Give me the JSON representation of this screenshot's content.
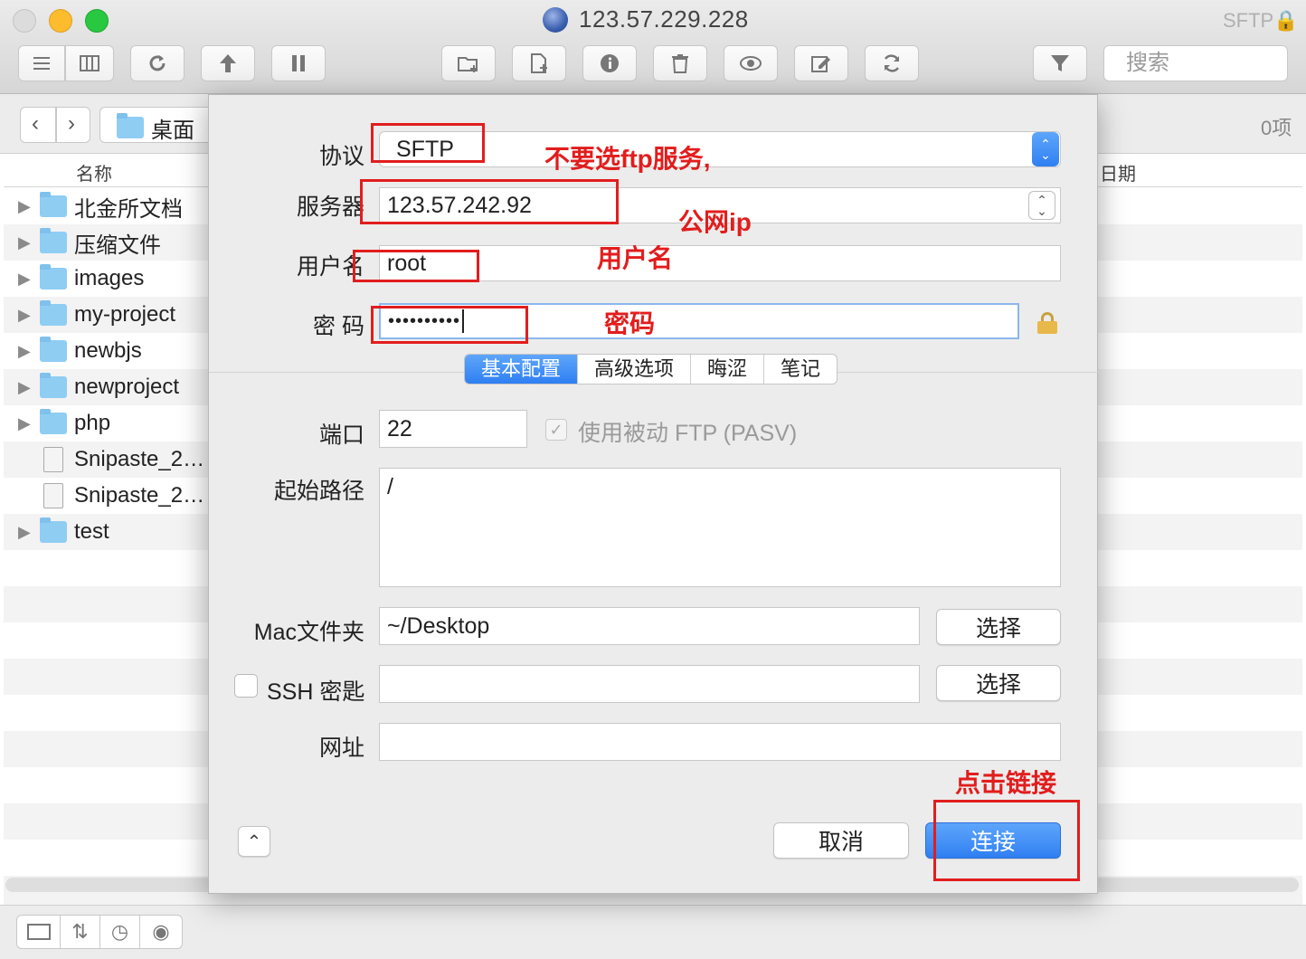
{
  "window": {
    "title": "123.57.229.228",
    "protocol_badge": "SFTP",
    "search_placeholder": "搜索"
  },
  "toolbar": {
    "icons": [
      "list-view-icon",
      "column-view-icon",
      "refresh-icon",
      "upload-icon",
      "pause-icon",
      "new-folder-icon",
      "new-file-icon",
      "info-icon",
      "trash-icon",
      "preview-icon",
      "edit-icon",
      "sync-icon",
      "filter-icon"
    ]
  },
  "browser": {
    "path": "桌面",
    "item_count": "0项",
    "columns": {
      "name": "名称",
      "date": "日期"
    },
    "files": [
      {
        "name": "北金所文档",
        "type": "folder"
      },
      {
        "name": "压缩文件",
        "type": "folder"
      },
      {
        "name": "images",
        "type": "folder"
      },
      {
        "name": "my-project",
        "type": "folder"
      },
      {
        "name": "newbjs",
        "type": "folder"
      },
      {
        "name": "newproject",
        "type": "folder"
      },
      {
        "name": "php",
        "type": "folder"
      },
      {
        "name": "Snipaste_2…",
        "type": "file"
      },
      {
        "name": "Snipaste_2…",
        "type": "file"
      },
      {
        "name": "test",
        "type": "folder"
      }
    ]
  },
  "dialog": {
    "protocol_label": "协议",
    "protocol_value": "SFTP",
    "server_label": "服务器",
    "server_value": "123.57.242.92",
    "user_label": "用户名",
    "user_value": "root",
    "password_label": "密 码",
    "password_value": "••••••••••",
    "tabs": [
      "基本配置",
      "高级选项",
      "晦涩",
      "笔记"
    ],
    "active_tab": "基本配置",
    "port_label": "端口",
    "port_value": "22",
    "pasv_label": "使用被动 FTP (PASV)",
    "pasv_checked": true,
    "path_label": "起始路径",
    "path_value": "/",
    "mac_folder_label": "Mac文件夹",
    "mac_folder_value": "~/Desktop",
    "choose_label": "选择",
    "ssh_key_label": "SSH 密匙",
    "ssh_key_checked": false,
    "ssh_key_value": "",
    "url_label": "网址",
    "url_value": "",
    "cancel_label": "取消",
    "connect_label": "连接"
  },
  "annotations": {
    "protocol_note": "不要选ftp服务,",
    "server_note": "公网ip",
    "user_note": "用户名",
    "password_note": "密码",
    "connect_note": "点击链接"
  },
  "colors": {
    "accent": "#2f7ff2",
    "annotation": "#e21d1d",
    "close": "#fc5f57",
    "minimize": "#fdbc2e",
    "zoom": "#28c840"
  }
}
